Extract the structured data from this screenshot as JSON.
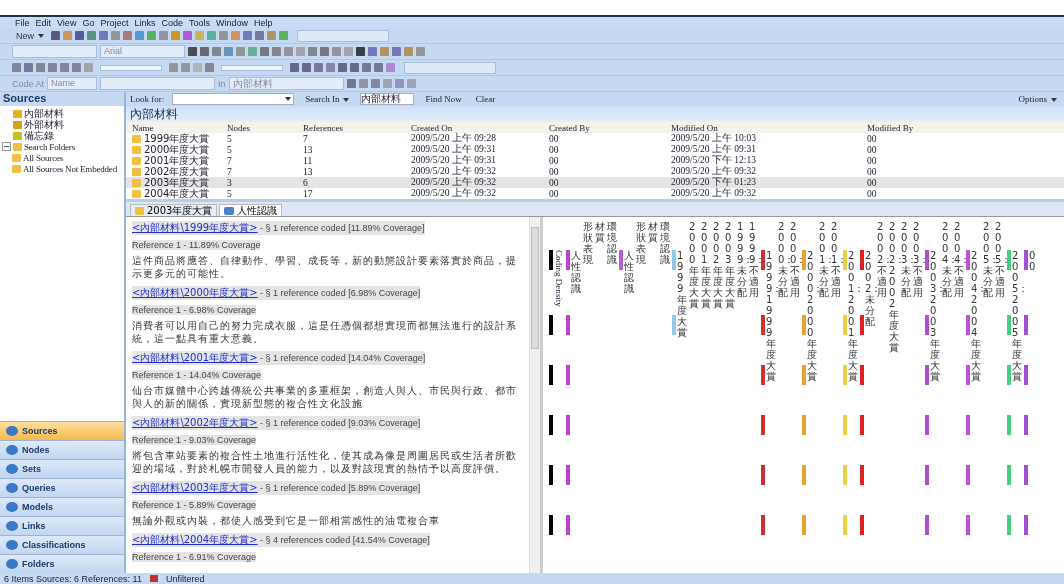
{
  "menu": [
    "File",
    "Edit",
    "View",
    "Go",
    "Project",
    "Links",
    "Code",
    "Tools",
    "Window",
    "Help"
  ],
  "toolbar": {
    "new_button": "New",
    "font_dropdown": "Arial",
    "code_at_label": "Code At",
    "name_dropdown": "Name",
    "in_label": "In",
    "in_dropdown": "內部材料"
  },
  "sources": {
    "title": "Sources",
    "tree": [
      {
        "label": "內部材料"
      },
      {
        "label": "外部材料"
      },
      {
        "label": "備忘錄"
      },
      {
        "label": "Search Folders",
        "expanded": true,
        "children": [
          {
            "label": "All Sources"
          },
          {
            "label": "All Sources Not Embedded"
          }
        ]
      }
    ]
  },
  "navigation": [
    {
      "label": "Sources",
      "selected": true
    },
    {
      "label": "Nodes",
      "selected": false
    },
    {
      "label": "Sets",
      "selected": false
    },
    {
      "label": "Queries",
      "selected": false
    },
    {
      "label": "Models",
      "selected": false
    },
    {
      "label": "Links",
      "selected": false
    },
    {
      "label": "Classifications",
      "selected": false
    },
    {
      "label": "Folders",
      "selected": false
    }
  ],
  "find_bar": {
    "look_for_label": "Look for:",
    "search_in_button": "Search In",
    "search_in_value": "內部材料",
    "find_now": "Find Now",
    "clear": "Clear",
    "options": "Options"
  },
  "list": {
    "title": "內部材料",
    "columns": [
      "Name",
      "Nodes",
      "References",
      "Created On",
      "Created By",
      "Modified On",
      "Modified By"
    ],
    "rows": [
      {
        "cells": [
          "1999年度大賞",
          "5",
          "7",
          "2009/5/20 上午 09:28",
          "00",
          "2009/5/20 上午 10:03",
          "00"
        ],
        "selected": false
      },
      {
        "cells": [
          "2000年度大賞",
          "5",
          "13",
          "2009/5/20 上午 09:31",
          "00",
          "2009/5/20 上午 09:31",
          "00"
        ],
        "selected": false
      },
      {
        "cells": [
          "2001年度大賞",
          "7",
          "11",
          "2009/5/20 上午 09:31",
          "00",
          "2009/5/20 下午 12:13",
          "00"
        ],
        "selected": false
      },
      {
        "cells": [
          "2002年度大賞",
          "7",
          "13",
          "2009/5/20 上午 09:32",
          "00",
          "2009/5/20 上午 09:32",
          "00"
        ],
        "selected": false
      },
      {
        "cells": [
          "2003年度大賞",
          "3",
          "6",
          "2009/5/20 上午 09:32",
          "00",
          "2009/5/20 下午 01:23",
          "00"
        ],
        "selected": true
      },
      {
        "cells": [
          "2004年度大賞",
          "5",
          "17",
          "2009/5/20 上午 09:32",
          "00",
          "2009/5/20 上午 09:32",
          "00"
        ],
        "selected": false
      }
    ]
  },
  "tabs": [
    {
      "label": "2003年度大賞",
      "kind": "document",
      "selected": false
    },
    {
      "label": "人性認識",
      "kind": "node",
      "selected": true
    }
  ],
  "references": [
    {
      "link": "<內部材料\\1999年度大賞>",
      "summary": " - § 1 reference coded  [11.89% Coverage]",
      "reference": "Reference 1 - 11.89% Coverage",
      "text": "這件商品將應答、自律動作、學習、成長等，新的動態設計要素落實於商品，提示更多元的可能性。"
    },
    {
      "link": "<內部材料\\2000年度大賞>",
      "summary": " - § 1 reference coded  [6.98% Coverage]",
      "reference": "Reference 1 - 6.98% Coverage",
      "text": "消費者可以用自己的努力完成衣服，這是任憑個都想實現而都無法進行的設計系統，這一點具有重大意義。"
    },
    {
      "link": "<內部材料\\2001年度大賞>",
      "summary": " - § 1 reference coded  [14.04% Coverage]",
      "reference": "Reference 1 - 14.04% Coverage",
      "text": "仙台市媒體中心跨越傳統公共事業的多重框架，創造人與人、市民與行政、都市與人的新的關係，實現新型態的複合性文化設施"
    },
    {
      "link": "<內部材料\\2002年度大賞>",
      "summary": " - § 1 reference coded  [9.03% Coverage]",
      "reference": "Reference 1 - 9.03% Coverage",
      "text": "將包含車站要素的複合性土地進行活性化，使其成為像是周圍居民或生活者所歡迎的場域，對於札幌市開發人員的能力，以及對該現實的熱情予以高度評價。"
    },
    {
      "link": "<內部材料\\2003年度大賞>",
      "summary": " - § 1 reference coded  [5.89% Coverage]",
      "reference": "Reference 1 - 5.89% Coverage",
      "text": "無論外觀或內裝，都使人感受到它是一部相當感性的油電複合車"
    },
    {
      "link": "<內部材料\\2004年度大賞>",
      "summary": " - § 4 references coded  [41.54% Coverage]",
      "reference": "Reference 1 - 6.91% Coverage"
    }
  ],
  "coding_stripes": [
    {
      "kind": "density",
      "label": "Coding Density",
      "color": "#000000",
      "coded": [
        true,
        true,
        true,
        true,
        true,
        true
      ]
    },
    {
      "kind": "code",
      "label": "人性認識",
      "color": "#c040d0",
      "coded": [
        true,
        true,
        true,
        true,
        true,
        true
      ]
    },
    {
      "kind": "label",
      "label": "形狀表現"
    },
    {
      "kind": "label",
      "label": "材質"
    },
    {
      "kind": "label",
      "label": "環境認識"
    },
    {
      "kind": "code",
      "label": "人性認識",
      "color": "#b060d0",
      "coded": [
        true,
        false,
        false,
        false,
        false,
        false
      ]
    },
    {
      "kind": "label",
      "label": "形狀表現"
    },
    {
      "kind": "label",
      "label": "材質"
    },
    {
      "kind": "label",
      "label": "環境認識"
    },
    {
      "kind": "code",
      "label": "1999年度大賞",
      "color": "#90c8e8",
      "coded": [
        true,
        true,
        false,
        false,
        false,
        false
      ]
    },
    {
      "kind": "label",
      "label": "2000年度大賞"
    },
    {
      "kind": "label",
      "label": "2001年度大賞"
    },
    {
      "kind": "label",
      "label": "2002年度大賞"
    },
    {
      "kind": "label",
      "label": "2003年度大賞"
    },
    {
      "kind": "label",
      "label": "1999：未分配"
    },
    {
      "kind": "label",
      "label": "1999：不適用"
    },
    {
      "kind": "code",
      "label": "1999：1999年度大賞",
      "color": "#d03030",
      "coded": [
        true,
        true,
        true,
        true,
        true,
        true
      ]
    },
    {
      "kind": "label",
      "label": "2000：未分配"
    },
    {
      "kind": "label",
      "label": "2000：不適用"
    },
    {
      "kind": "code",
      "label": "2000：2000年度大賞",
      "color": "#e8a030",
      "coded": [
        true,
        true,
        true,
        true,
        true,
        true
      ]
    },
    {
      "kind": "label",
      "label": "2001：未分配"
    },
    {
      "kind": "label",
      "label": "2001：不適用"
    },
    {
      "kind": "code",
      "label": "2001：2001年度大賞",
      "color": "#e8d040",
      "coded": [
        true,
        true,
        true,
        true,
        true,
        true
      ]
    },
    {
      "kind": "code",
      "label": "2002：未分配",
      "color": "#e02020",
      "coded": [
        true,
        true,
        true,
        true,
        true,
        true
      ]
    },
    {
      "kind": "label",
      "label": "2002：不適用"
    },
    {
      "kind": "label",
      "label": "2002：2002年度大賞"
    },
    {
      "kind": "label",
      "label": "2003：未分配"
    },
    {
      "kind": "label",
      "label": "2003：不適用"
    },
    {
      "kind": "code",
      "label": "2003：2003年度大賞",
      "color": "#b050d0",
      "coded": [
        true,
        true,
        true,
        true,
        true,
        true
      ]
    },
    {
      "kind": "label",
      "label": "2004：未分配"
    },
    {
      "kind": "label",
      "label": "2004：不適用"
    },
    {
      "kind": "code",
      "label": "2004：2004年度大賞",
      "color": "#c050d8",
      "coded": [
        true,
        true,
        true,
        true,
        true,
        true
      ]
    },
    {
      "kind": "label",
      "label": "2005：未分配"
    },
    {
      "kind": "label",
      "label": "2005：不適用"
    },
    {
      "kind": "code",
      "label": "2005：2005年度大賞",
      "color": "#40d080",
      "coded": [
        true,
        true,
        true,
        true,
        true,
        true
      ]
    },
    {
      "kind": "code",
      "label": "00",
      "color": "#a050d0",
      "coded": [
        true,
        true,
        true,
        true,
        true,
        true
      ]
    }
  ],
  "status_bar": {
    "summary": "6 Items  Sources: 6  References: 11",
    "filter": "Unfiltered"
  }
}
